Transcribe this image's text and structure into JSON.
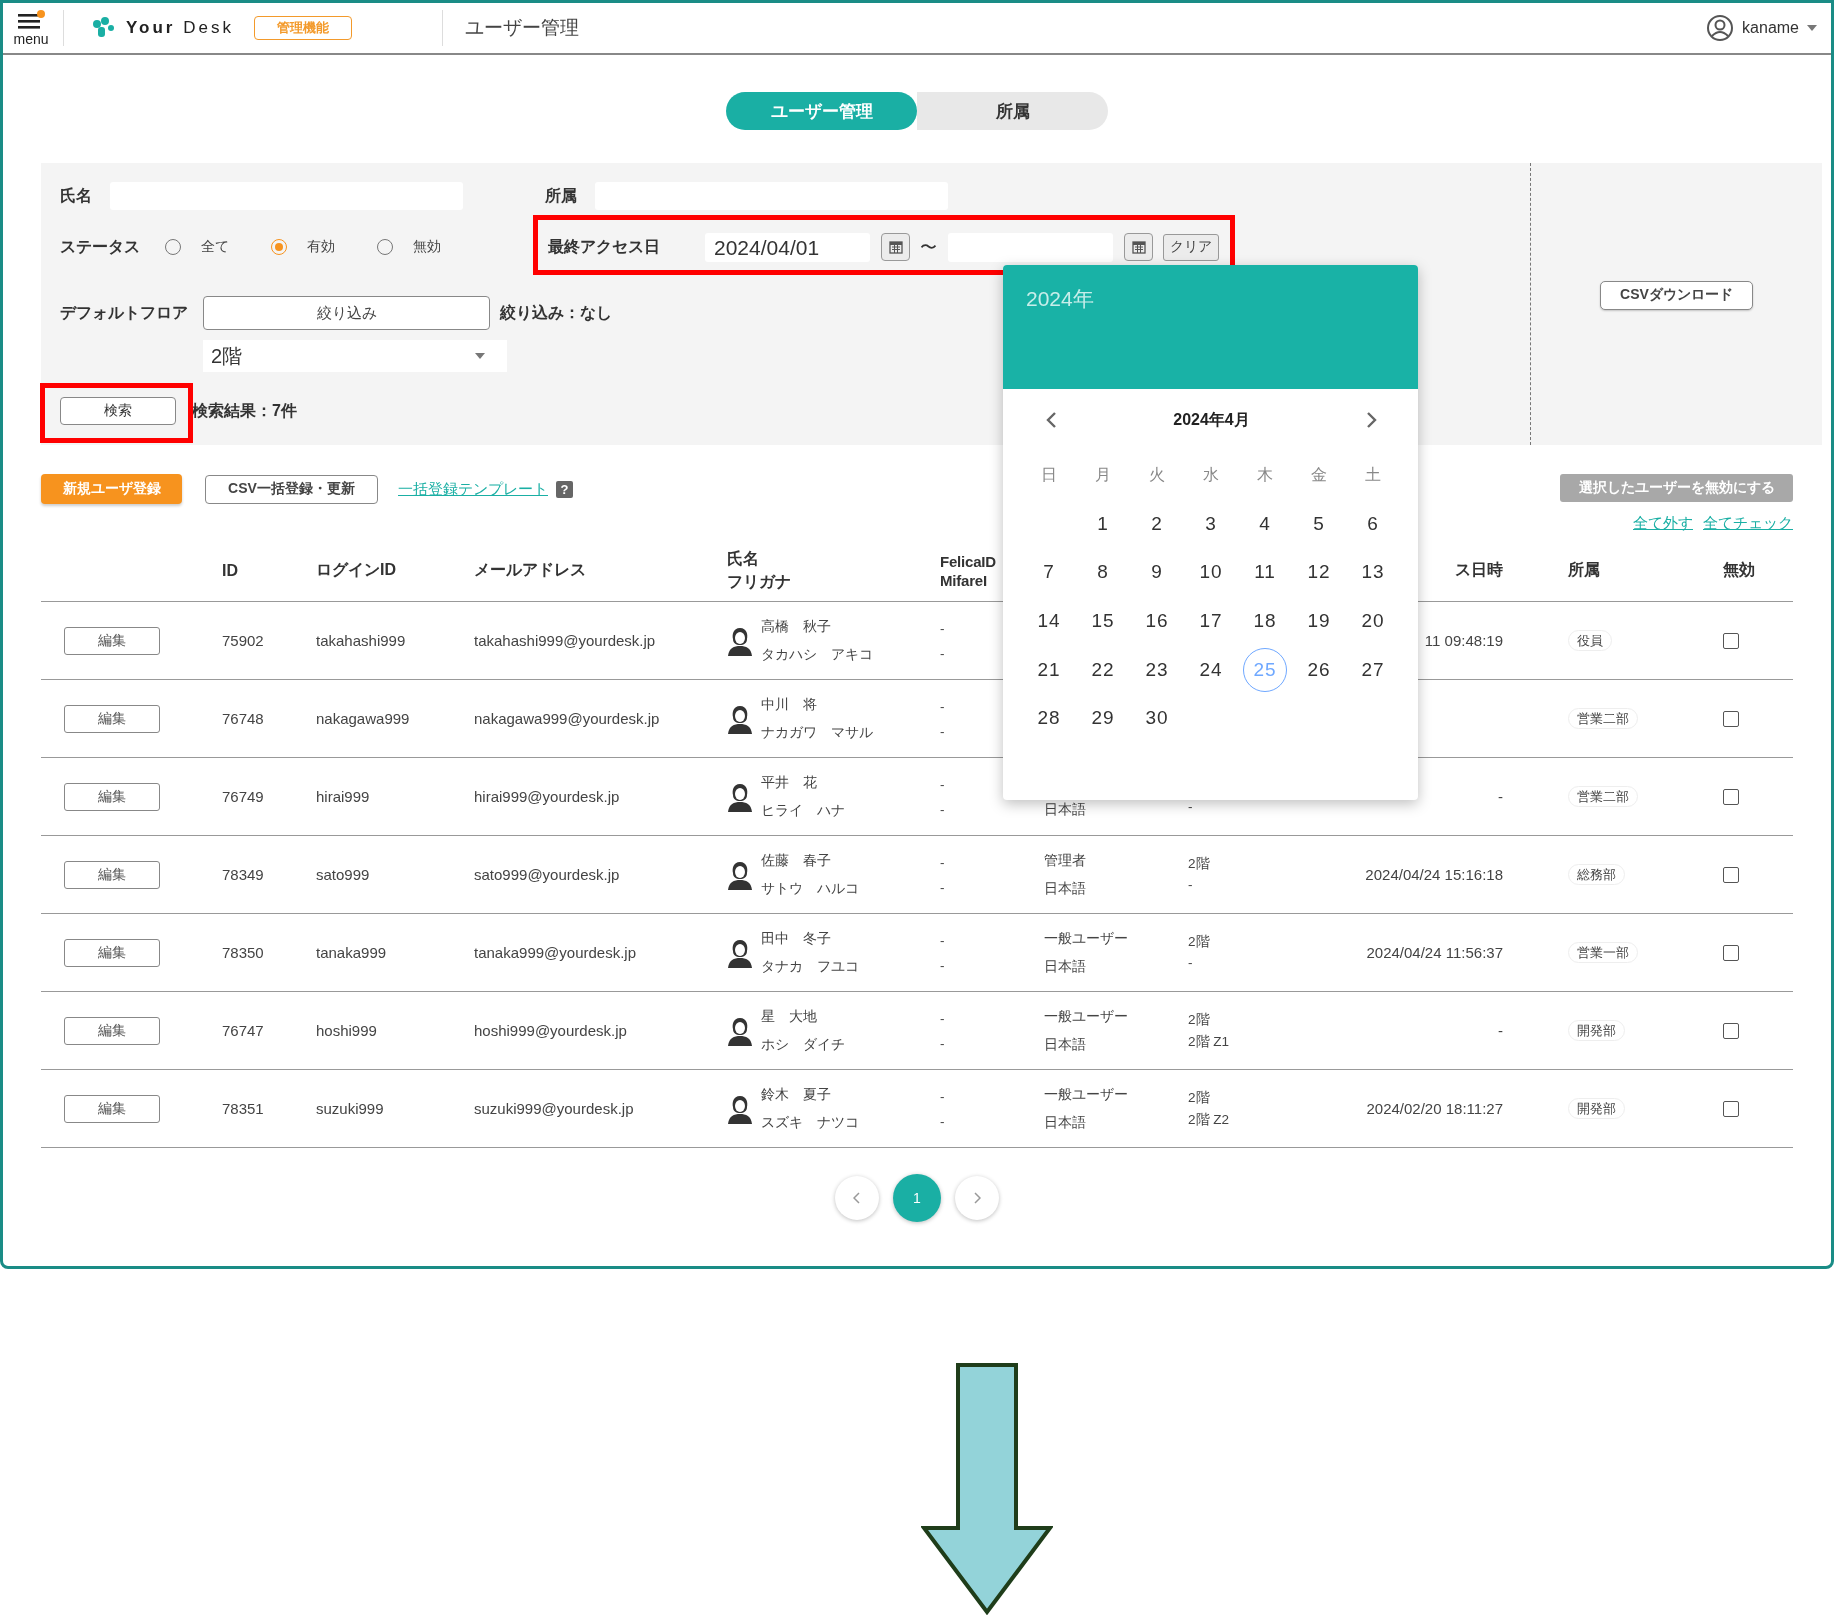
{
  "header": {
    "menu_label": "menu",
    "logo": "**Your** Desk",
    "badge": "管理機能",
    "page_title": "ユーザー管理",
    "user": "kaname"
  },
  "tabs": [
    {
      "label": "ユーザー管理",
      "selected": true
    },
    {
      "label": "所属",
      "selected": false
    }
  ],
  "filters": {
    "name_label": "氏名",
    "department_label": "所属",
    "status_label": "ステータス",
    "status_options": [
      {
        "label": "全て",
        "selected": false
      },
      {
        "label": "有効",
        "selected": true
      },
      {
        "label": "無効",
        "selected": false
      }
    ],
    "last_access_label": "最終アクセス日",
    "date_from": "2024/04/01",
    "range_sep": "〜",
    "clear_button": "クリア",
    "floor_label": "デフォルトフロア",
    "narrow_button": "絞り込み",
    "narrow_status": "絞り込み：なし",
    "floor_select": "2階",
    "search_button": "検索",
    "result_count": "検索結果：7件",
    "csv_download": "CSVダウンロード"
  },
  "actions": {
    "new_user": "新規ユーザ登録",
    "csv_import": "CSV一括登録・更新",
    "template_link": "一括登録テンプレート",
    "help_mark": "?",
    "deactivate_selected": "選択したユーザーを無効にする",
    "uncheck_all": "全て外す",
    "check_all": "全てチェック"
  },
  "table": {
    "headers": {
      "id": "ID",
      "login_id": "ログインID",
      "email": "メールアドレス",
      "name": [
        "氏名",
        "フリガナ"
      ],
      "card": [
        "FelicaID",
        "MifareI"
      ],
      "last_access": "ス日時",
      "department": "所属",
      "deactivate": "無効"
    },
    "rows": [
      {
        "edit": "編集",
        "id": "75902",
        "login_id": "takahashi999",
        "email": "takahashi999@yourdesk.jp",
        "name": "高橋　秋子",
        "kana": "タカハシ　アキコ",
        "felica": "-",
        "mifare": "-",
        "last_access": "11 09:48:19",
        "department": "役員",
        "deactivate": false
      },
      {
        "edit": "編集",
        "id": "76748",
        "login_id": "nakagawa999",
        "email": "nakagawa999@yourdesk.jp",
        "name": "中川　将",
        "kana": "ナカガワ　マサル",
        "felica": "-",
        "mifare": "-",
        "department": "営業二部",
        "deactivate": false
      },
      {
        "edit": "編集",
        "id": "76749",
        "login_id": "hirai999",
        "email": "hirai999@yourdesk.jp",
        "name": "平井　花",
        "kana": "ヒライ　ハナ",
        "felica": "-",
        "mifare": "-",
        "language": "日本語",
        "floor_zone": "-",
        "last_access": "-",
        "department": "営業二部",
        "deactivate": false
      },
      {
        "edit": "編集",
        "id": "78349",
        "login_id": "sato999",
        "email": "sato999@yourdesk.jp",
        "name": "佐藤　春子",
        "kana": "サトウ　ハルコ",
        "felica": "-",
        "mifare": "-",
        "role": "管理者",
        "language": "日本語",
        "floor": "2階",
        "floor_zone": "-",
        "last_access": "2024/04/24 15:16:18",
        "department": "総務部",
        "deactivate": false
      },
      {
        "edit": "編集",
        "id": "78350",
        "login_id": "tanaka999",
        "email": "tanaka999@yourdesk.jp",
        "name": "田中　冬子",
        "kana": "タナカ　フユコ",
        "felica": "-",
        "mifare": "-",
        "role": "一般ユーザー",
        "language": "日本語",
        "floor": "2階",
        "floor_zone": "-",
        "last_access": "2024/04/24 11:56:37",
        "department": "営業一部",
        "deactivate": false
      },
      {
        "edit": "編集",
        "id": "76747",
        "login_id": "hoshi999",
        "email": "hoshi999@yourdesk.jp",
        "name": "星　大地",
        "kana": "ホシ　ダイチ",
        "felica": "-",
        "mifare": "-",
        "role": "一般ユーザー",
        "language": "日本語",
        "floor": "2階",
        "floor_zone": "2階 Z1",
        "last_access": "-",
        "department": "開発部",
        "deactivate": false
      },
      {
        "edit": "編集",
        "id": "78351",
        "login_id": "suzuki999",
        "email": "suzuki999@yourdesk.jp",
        "name": "鈴木　夏子",
        "kana": "スズキ　ナツコ",
        "felica": "-",
        "mifare": "-",
        "role": "一般ユーザー",
        "language": "日本語",
        "floor": "2階",
        "floor_zone": "2階 Z2",
        "last_access": "2024/02/20 18:11:27",
        "department": "開発部",
        "deactivate": false
      }
    ]
  },
  "pagination": {
    "pages": [
      {
        "label": "1",
        "selected": true
      }
    ]
  },
  "calendar": {
    "year_heading": "2024年",
    "month_heading": "2024年4月",
    "weekdays": [
      "日",
      "月",
      "火",
      "水",
      "木",
      "金",
      "土"
    ],
    "weeks": [
      {
        "days": [
          {
            "label": "1",
            "selected": false
          },
          {
            "label": "2",
            "selected": false
          },
          {
            "label": "3",
            "selected": false
          },
          {
            "label": "4",
            "selected": false
          },
          {
            "label": "5",
            "selected": false
          },
          {
            "label": "6",
            "selected": false
          }
        ]
      },
      {
        "days": [
          {
            "label": "7",
            "selected": false
          },
          {
            "label": "8",
            "selected": false
          },
          {
            "label": "9",
            "selected": false
          },
          {
            "label": "10",
            "selected": false
          },
          {
            "label": "11",
            "selected": false
          },
          {
            "label": "12",
            "selected": false
          },
          {
            "label": "13",
            "selected": false
          }
        ]
      },
      {
        "days": [
          {
            "label": "14",
            "selected": false
          },
          {
            "label": "15",
            "selected": false
          },
          {
            "label": "16",
            "selected": false
          },
          {
            "label": "17",
            "selected": false
          },
          {
            "label": "18",
            "selected": false
          },
          {
            "label": "19",
            "selected": false
          },
          {
            "label": "20",
            "selected": false
          }
        ]
      },
      {
        "days": [
          {
            "label": "21",
            "selected": false
          },
          {
            "label": "22",
            "selected": false
          },
          {
            "label": "23",
            "selected": false
          },
          {
            "label": "24",
            "selected": false
          },
          {
            "label": "25",
            "selected": true
          },
          {
            "label": "26",
            "selected": false
          },
          {
            "label": "27",
            "selected": false
          }
        ]
      },
      {
        "days": [
          {
            "label": "28",
            "selected": false
          },
          {
            "label": "29",
            "selected": false
          },
          {
            "label": "30",
            "selected": false
          }
        ]
      }
    ]
  }
}
